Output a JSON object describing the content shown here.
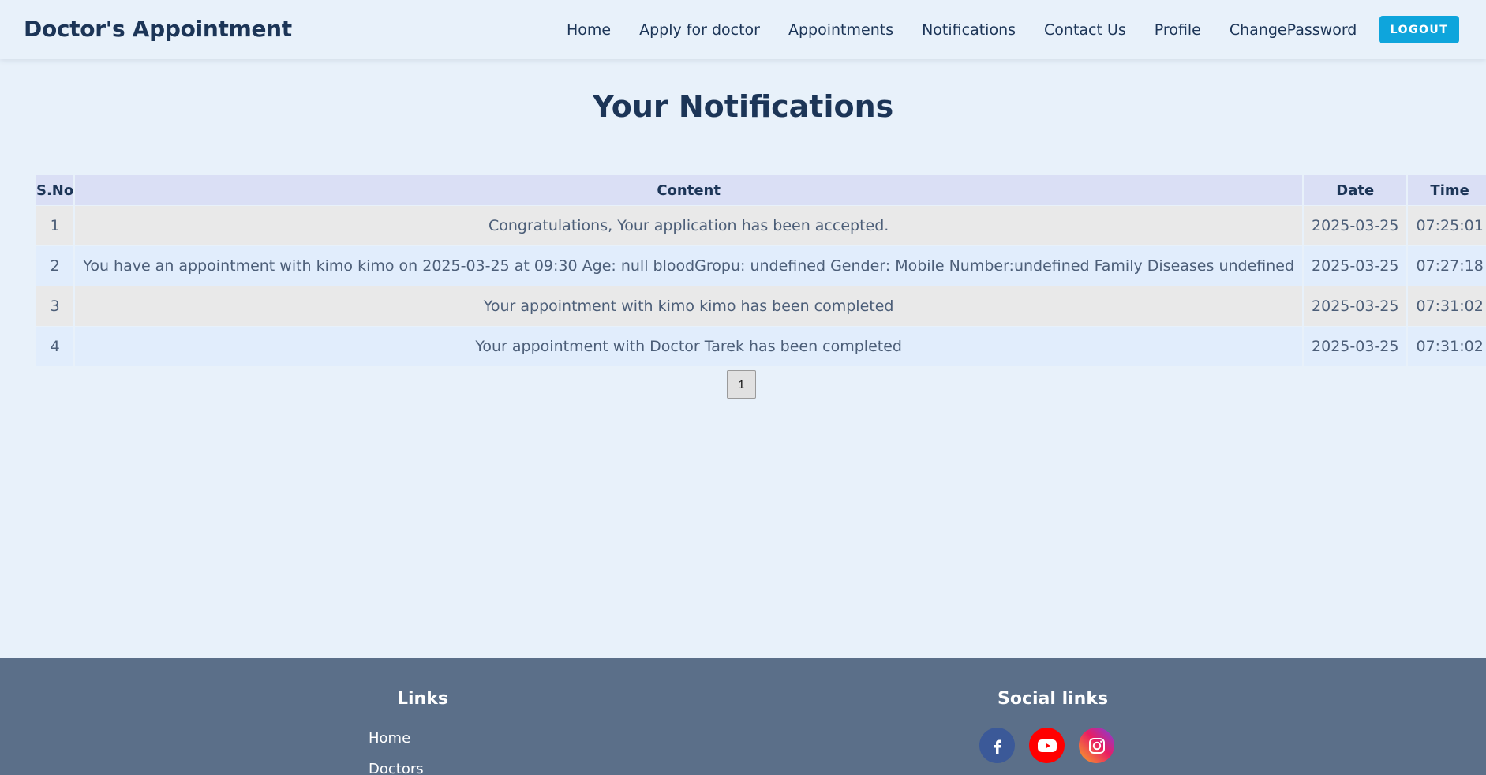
{
  "header": {
    "brand": "Doctor's Appointment",
    "nav": [
      "Home",
      "Apply for doctor",
      "Appointments",
      "Notifications",
      "Contact Us",
      "Profile",
      "ChangePassword"
    ],
    "logout_label": "LOGOUT"
  },
  "main": {
    "title": "Your Notifications",
    "table": {
      "headers": [
        "S.No",
        "Content",
        "Date",
        "Time"
      ],
      "rows": [
        [
          "1",
          "Congratulations, Your application has been accepted.",
          "2025-03-25",
          "07:25:01"
        ],
        [
          "2",
          "You have an appointment with kimo kimo on 2025-03-25 at 09:30 Age: null bloodGropu: undefined Gender: Mobile Number:undefined Family Diseases undefined",
          "2025-03-25",
          "07:27:18"
        ],
        [
          "3",
          "Your appointment with kimo kimo has been completed",
          "2025-03-25",
          "07:31:02"
        ],
        [
          "4",
          "Your appointment with Doctor Tarek has been completed",
          "2025-03-25",
          "07:31:02"
        ]
      ]
    },
    "pagination": {
      "current": "1"
    }
  },
  "footer": {
    "links_title": "Links",
    "links": [
      "Home",
      "Doctors"
    ],
    "social_title": "Social links",
    "social_icons": [
      "facebook-icon",
      "youtube-icon",
      "instagram-icon"
    ]
  },
  "colors": {
    "background": "#e8f1fa",
    "primary_text": "#1c3557",
    "logout_button": "#0ea5dc",
    "footer": "#5b6f89",
    "table_header": "#dadff5",
    "row_odd": "#e9e9e9",
    "row_even": "#e1edfc"
  }
}
